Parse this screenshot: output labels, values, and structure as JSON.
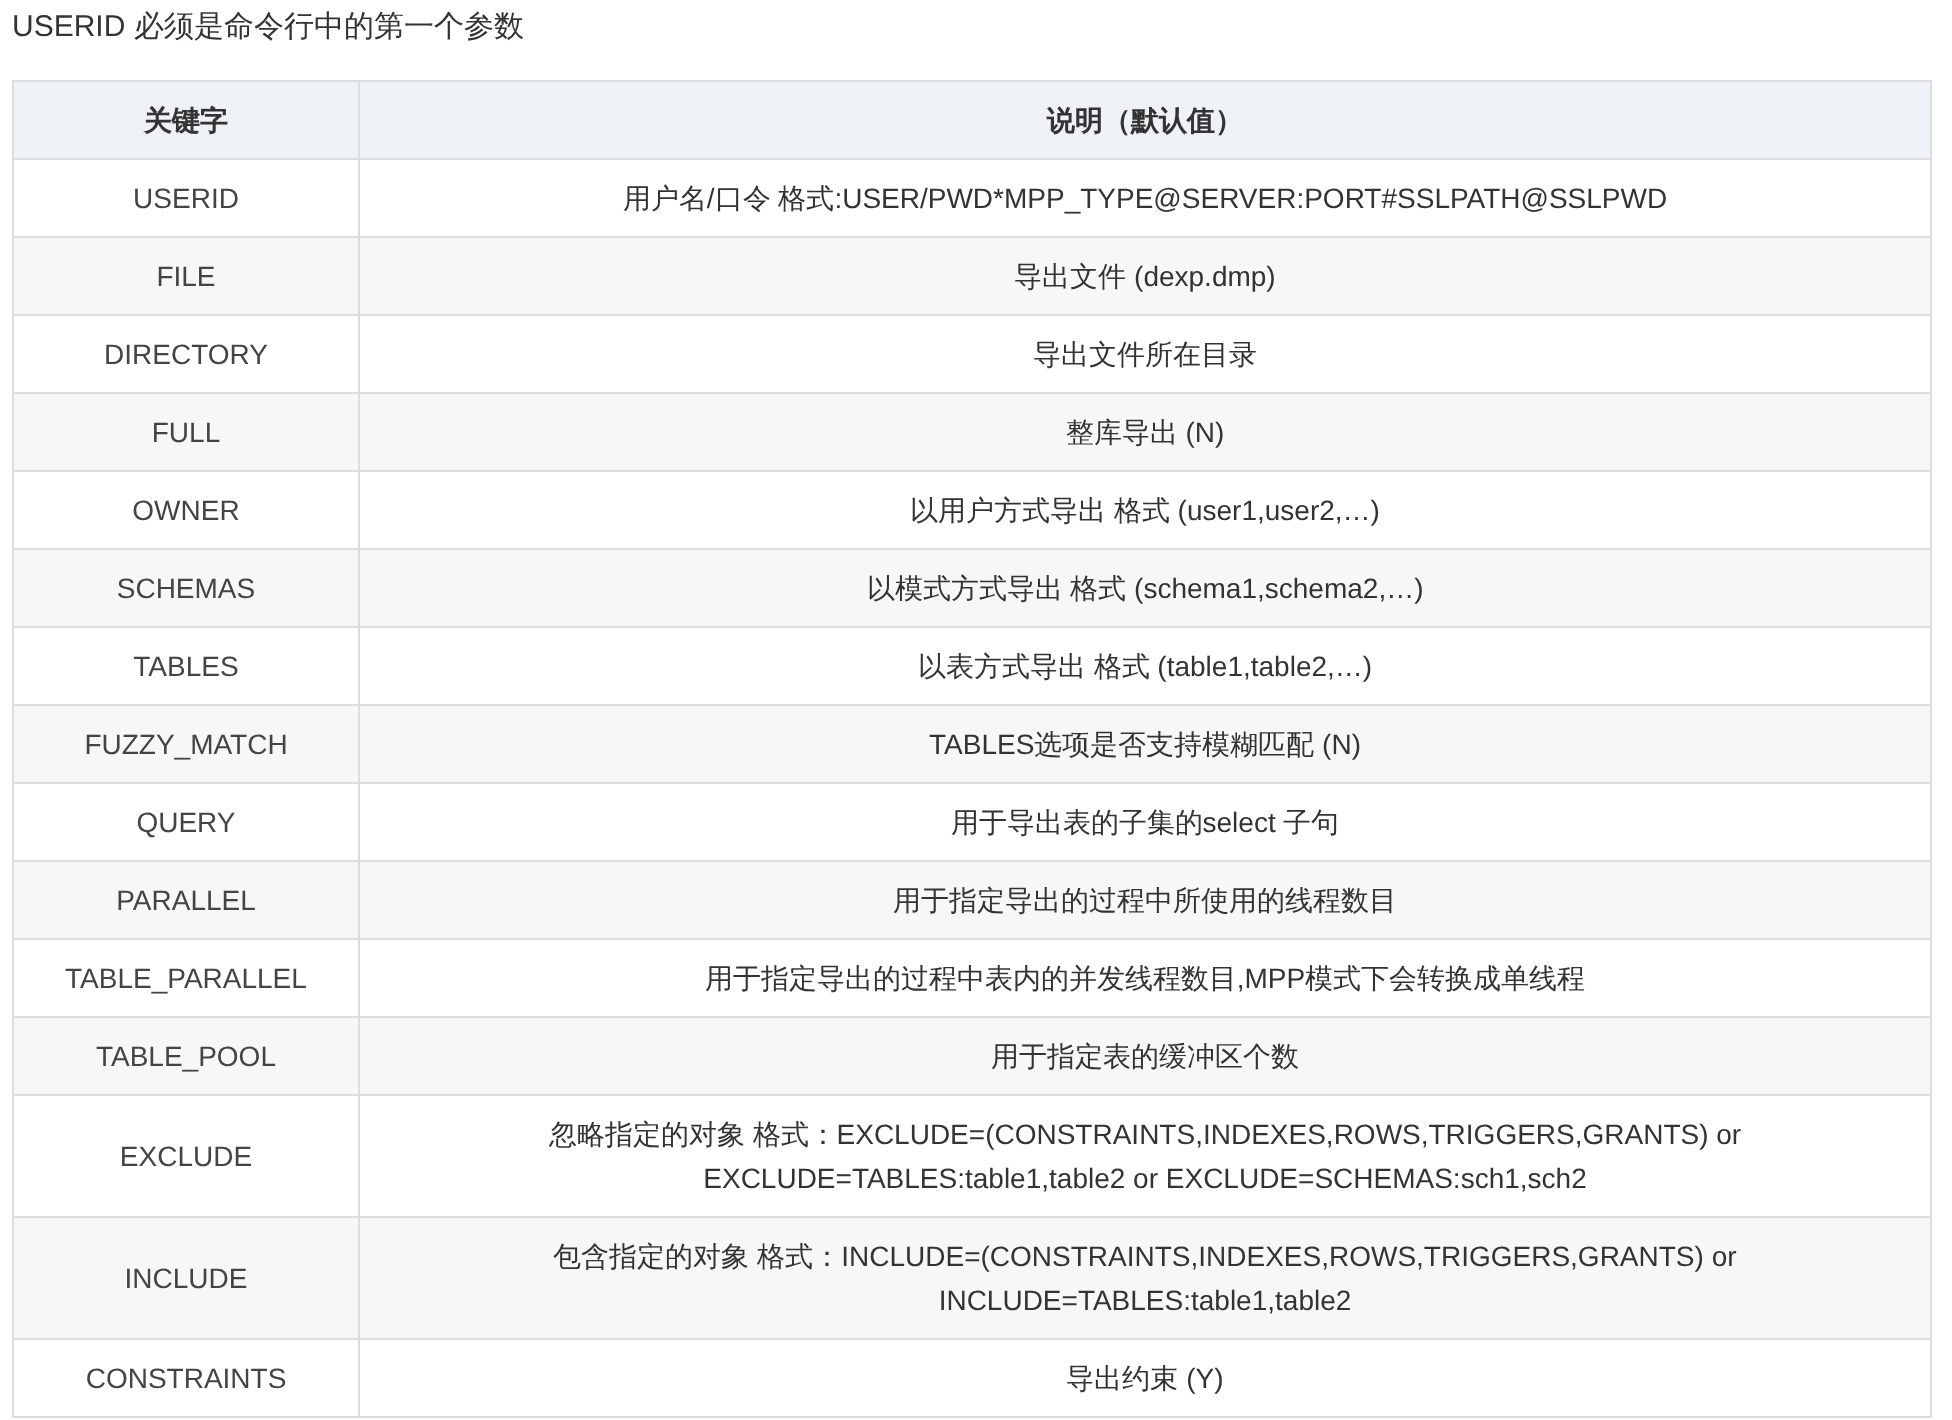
{
  "intro": "USERID 必须是命令行中的第一个参数",
  "table": {
    "columns": [
      "关键字",
      "说明（默认值）"
    ],
    "rows": [
      {
        "keyword": "USERID",
        "description": "用户名/口令 格式:USER/PWD*MPP_TYPE@SERVER:PORT#SSLPATH@SSLPWD"
      },
      {
        "keyword": "FILE",
        "description": "导出文件 (dexp.dmp)"
      },
      {
        "keyword": "DIRECTORY",
        "description": "导出文件所在目录"
      },
      {
        "keyword": "FULL",
        "description": "整库导出 (N)"
      },
      {
        "keyword": "OWNER",
        "description": "以用户方式导出 格式 (user1,user2,…)"
      },
      {
        "keyword": "SCHEMAS",
        "description": "以模式方式导出 格式 (schema1,schema2,…)"
      },
      {
        "keyword": "TABLES",
        "description": "以表方式导出 格式 (table1,table2,…)"
      },
      {
        "keyword": "FUZZY_MATCH",
        "description": "TABLES选项是否支持模糊匹配 (N)"
      },
      {
        "keyword": "QUERY",
        "description": "用于导出表的子集的select 子句"
      },
      {
        "keyword": "PARALLEL",
        "description": "用于指定导出的过程中所使用的线程数目"
      },
      {
        "keyword": "TABLE_PARALLEL",
        "description": "用于指定导出的过程中表内的并发线程数目,MPP模式下会转换成单线程"
      },
      {
        "keyword": "TABLE_POOL",
        "description": "用于指定表的缓冲区个数"
      },
      {
        "keyword": "EXCLUDE",
        "description": "忽略指定的对象 格式：EXCLUDE=(CONSTRAINTS,INDEXES,ROWS,TRIGGERS,GRANTS) or EXCLUDE=TABLES:table1,table2 or EXCLUDE=SCHEMAS:sch1,sch2"
      },
      {
        "keyword": "INCLUDE",
        "description": "包含指定的对象 格式：INCLUDE=(CONSTRAINTS,INDEXES,ROWS,TRIGGERS,GRANTS) or INCLUDE=TABLES:table1,table2"
      },
      {
        "keyword": "CONSTRAINTS",
        "description": "导出约束 (Y)"
      }
    ]
  }
}
